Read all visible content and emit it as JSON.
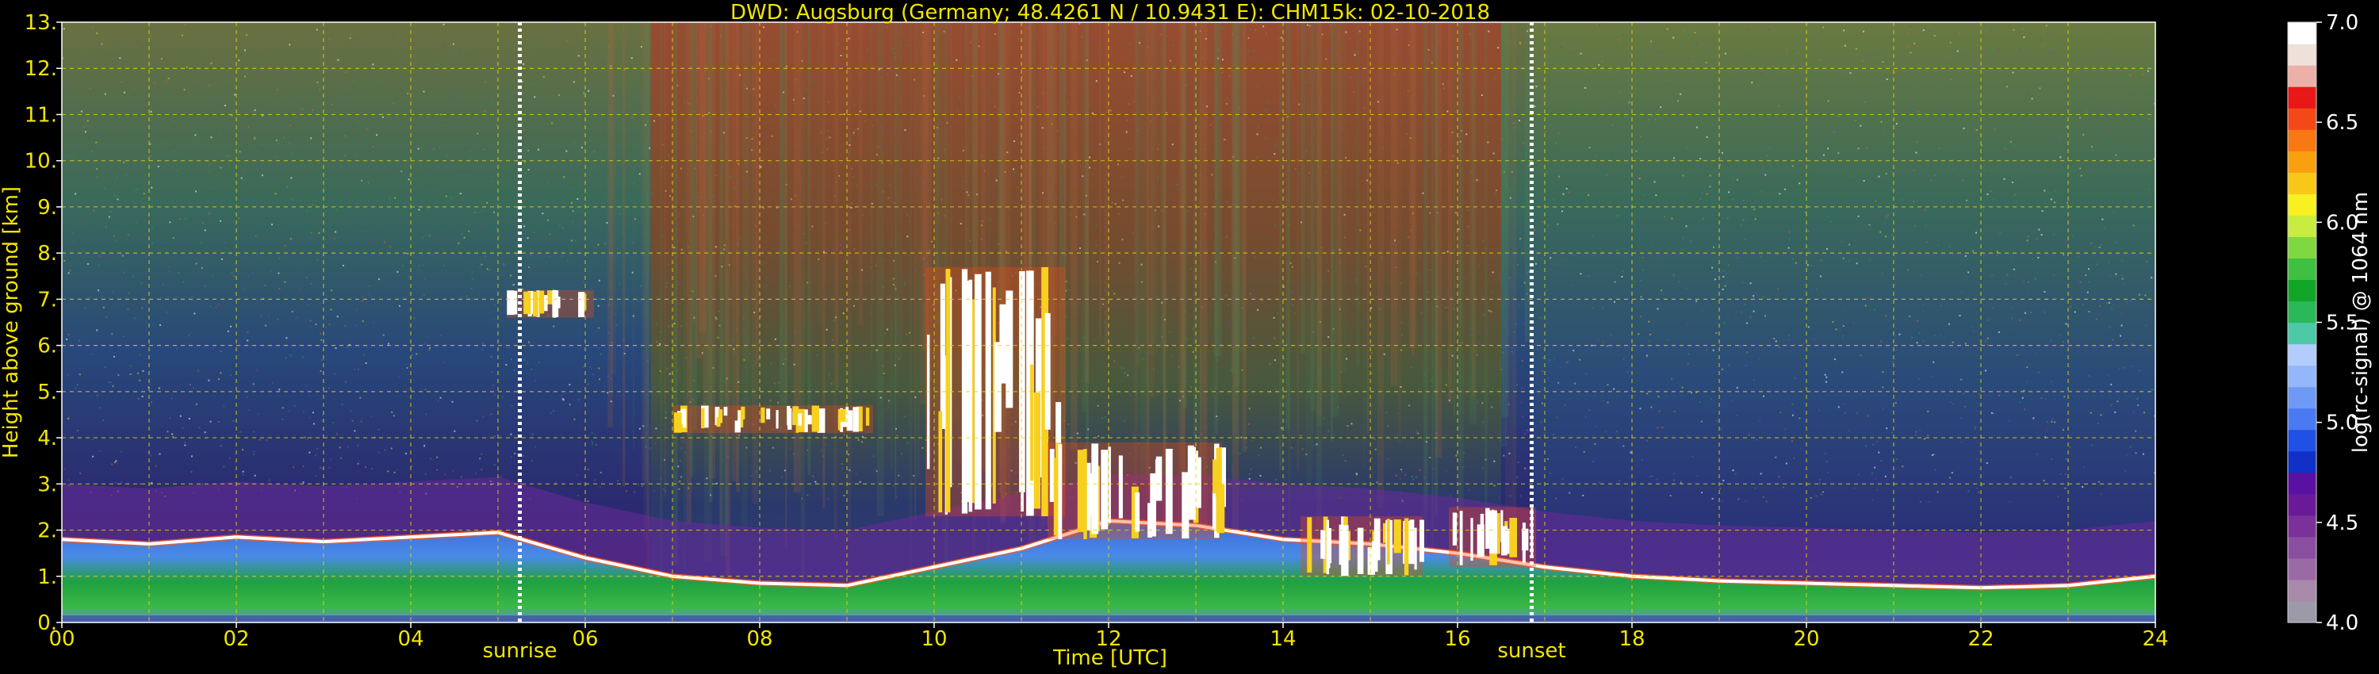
{
  "chart_data": {
    "type": "heatmap",
    "title": "DWD: Augsburg (Germany; 48.4261 N / 10.9431 E):    CHM15k: 02-10-2018",
    "xlabel": "Time [UTC]",
    "ylabel": "Height above ground [km]",
    "xlim": [
      0,
      24
    ],
    "ylim": [
      0,
      13
    ],
    "x_ticks": [
      "00",
      "02",
      "04",
      "06",
      "08",
      "10",
      "12",
      "14",
      "16",
      "18",
      "20",
      "22",
      "24"
    ],
    "y_ticks": [
      "0.",
      "1.",
      "2.",
      "3.",
      "4.",
      "5.",
      "6.",
      "7.",
      "8.",
      "9.",
      "10.",
      "11.",
      "12.",
      "13."
    ],
    "grid": true,
    "colorbar": {
      "label": "log(rc-signal) @ 1064 nm",
      "range": [
        4.0,
        7.0
      ],
      "ticks": [
        "4.0",
        "4.5",
        "5.0",
        "5.5",
        "6.0",
        "6.5",
        "7.0"
      ],
      "colors": [
        "#9c9aa8",
        "#a78aaa",
        "#9a6aa4",
        "#8a4ea0",
        "#7a329a",
        "#6a1a96",
        "#5a10a0",
        "#1030c8",
        "#2050e6",
        "#4a7af2",
        "#6e9af6",
        "#94b6fa",
        "#b2ccfc",
        "#4cc8a8",
        "#2ab858",
        "#12a628",
        "#40c040",
        "#80d840",
        "#c8ec40",
        "#f8f020",
        "#f8c818",
        "#f8a010",
        "#f87814",
        "#f44818",
        "#e81818",
        "#ecb0a8",
        "#efe0da",
        "#ffffff"
      ]
    },
    "annotations": [
      {
        "text": "sunrise",
        "x": 5.25
      },
      {
        "text": "sunset",
        "x": 16.85
      }
    ],
    "features": {
      "boundary_layer_top_km": {
        "x": [
          0,
          1,
          2,
          3,
          4,
          5,
          6,
          7,
          8,
          9,
          10,
          11,
          12,
          13,
          14,
          15,
          16,
          17,
          18,
          19,
          20,
          21,
          22,
          23,
          24
        ],
        "y": [
          1.8,
          1.7,
          1.85,
          1.75,
          1.85,
          1.95,
          1.4,
          1.0,
          0.85,
          0.8,
          1.2,
          1.6,
          2.2,
          2.1,
          1.8,
          1.7,
          1.5,
          1.2,
          1.0,
          0.9,
          0.85,
          0.8,
          0.75,
          0.8,
          1.0
        ]
      },
      "cloud_layers_km": [
        {
          "x_start": 5.1,
          "x_end": 6.1,
          "y_bottom": 6.6,
          "y_top": 7.2
        },
        {
          "x_start": 7.0,
          "x_end": 9.3,
          "y_bottom": 4.1,
          "y_top": 4.7
        },
        {
          "x_start": 9.9,
          "x_end": 11.5,
          "y_bottom": 2.3,
          "y_top": 7.7
        },
        {
          "x_start": 11.3,
          "x_end": 13.3,
          "y_bottom": 1.8,
          "y_top": 3.9
        },
        {
          "x_start": 14.2,
          "x_end": 15.6,
          "y_bottom": 1.0,
          "y_top": 2.3
        },
        {
          "x_start": 15.9,
          "x_end": 16.9,
          "y_bottom": 1.2,
          "y_top": 2.5
        }
      ]
    }
  }
}
